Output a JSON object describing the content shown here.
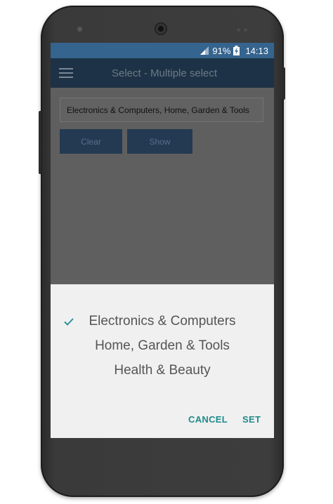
{
  "status_bar": {
    "battery_percent": "91%",
    "time": "14:13"
  },
  "app_bar": {
    "title": "Select - Multiple select"
  },
  "selection_field": {
    "value": "Electronics & Computers, Home, Garden & Tools"
  },
  "buttons": {
    "clear_label": "Clear",
    "show_label": "Show"
  },
  "picker": {
    "options": [
      {
        "label": "Electronics & Computers",
        "checked": true
      },
      {
        "label": "Home, Garden & Tools",
        "checked": false
      },
      {
        "label": "Health & Beauty",
        "checked": false
      }
    ],
    "cancel_label": "CANCEL",
    "set_label": "SET"
  },
  "colors": {
    "status_bar": "#35648e",
    "app_bar": "#1d3246",
    "button": "#233a52",
    "accent": "#1e8a8a",
    "sheet": "#f0f0f0"
  },
  "icons": [
    "signal-icon",
    "battery-charging-icon",
    "menu-icon",
    "check-icon"
  ]
}
